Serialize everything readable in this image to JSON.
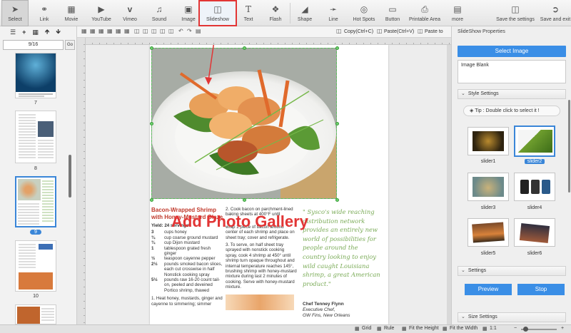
{
  "toolbar": {
    "items": [
      {
        "label": "Select",
        "icon": "arrow-icon"
      },
      {
        "label": "Link",
        "icon": "link-icon"
      },
      {
        "label": "Movie",
        "icon": "film-icon"
      },
      {
        "label": "YouTube",
        "icon": "youtube-icon"
      },
      {
        "label": "Vimeo",
        "icon": "vimeo-icon"
      },
      {
        "label": "Sound",
        "icon": "music-note-icon"
      },
      {
        "label": "Image",
        "icon": "image-icon"
      },
      {
        "label": "Slideshow",
        "icon": "slideshow-icon"
      },
      {
        "label": "Text",
        "icon": "text-icon"
      },
      {
        "label": "Flash",
        "icon": "flash-icon"
      },
      {
        "label": "Shape",
        "icon": "shape-icon"
      },
      {
        "label": "Line",
        "icon": "line-icon"
      },
      {
        "label": "Hot Spots",
        "icon": "hotspot-icon"
      },
      {
        "label": "Button",
        "icon": "button-icon"
      },
      {
        "label": "Printable Area",
        "icon": "printer-icon"
      },
      {
        "label": "more",
        "icon": "more-icon"
      },
      {
        "label": "Save the settings",
        "icon": "save-icon"
      },
      {
        "label": "Save and exit",
        "icon": "exit-icon"
      }
    ]
  },
  "left_panel": {
    "page_indicator": "9/16",
    "go_label": "Go",
    "thumbnails": [
      {
        "label": "7"
      },
      {
        "label": "8"
      },
      {
        "label": "9"
      },
      {
        "label": "10"
      }
    ]
  },
  "edit_tools": {
    "copy": "Copy(Ctrl+C)",
    "paste": "Paste(Ctrl+V)",
    "paste_to": "Paste to"
  },
  "article": {
    "title_line1": "Bacon-Wrapped Shrimp",
    "title_line2": "with Honey-Mustard Glaze",
    "yield": "Yield: 24 servings",
    "ingredients": [
      {
        "qty": "3",
        "text": "cups honey"
      },
      {
        "qty": "¾",
        "text": "cup coarse ground mustard"
      },
      {
        "qty": "¾",
        "text": "cup Dijon mustard"
      },
      {
        "qty": "1",
        "text": "tablespoon grated fresh ginger"
      },
      {
        "qty": "½",
        "text": "teaspoon cayenne pepper"
      },
      {
        "qty": "2½",
        "text": "pounds smoked bacon slices, each cut crosswise in half"
      },
      {
        "qty": "",
        "text": "Nonstick cooking spray"
      },
      {
        "qty": "5½",
        "text": "pounds raw 16-20 count tail-on, peeled and deveined Portico shrimp, thawed"
      }
    ],
    "step1": "1. Heat honey, mustards, ginger and cayenne to simmering; simmer",
    "step2": "2. Cook bacon on parchment-lined baking sheets at 400°F until",
    "step3": "wrap 1 piece of bacon around center of each shrimp and place on sheet tray; cover and refrigerate.",
    "step4": "3. To serve, on half sheet tray sprayed with nonstick cooking spray, cook 4 shrimp at 450° until shrimp turn opaque throughout and internal temperature reaches 145°, brushing shrimp with honey-mustard mixture during last 2 minutes of cooking. Serve with honey-mustard mixture.",
    "quote": "\" Sysco's wide reaching distribution network provides an entirely new world of possibilities for people around the country looking to enjoy wild caught Louisiana shrimp, a great American product.\"",
    "chef_name": "Chef Tenney Flynn",
    "chef_title": "Executive Chef,",
    "chef_place": "GW Fins, New Orleans"
  },
  "overlay_caption": "Add Photo Gallery",
  "right_panel": {
    "title": "SlideShow Properties",
    "select_image": "Select Image",
    "image_blank": "Image Blank",
    "style_settings": "Style Settings",
    "tip": "Tip : Double click to select it !",
    "sliders": [
      {
        "label": "slider1"
      },
      {
        "label": "slider2"
      },
      {
        "label": "slider3"
      },
      {
        "label": "slider4"
      },
      {
        "label": "slider5"
      },
      {
        "label": "slider6"
      }
    ],
    "settings": "Settings",
    "preview": "Preview",
    "stop": "Stop",
    "size_settings": "Size Settings"
  },
  "status_bar": {
    "grid": "Grid",
    "rule": "Rule",
    "fit_height": "Fit the Height",
    "fit_width": "Fit the Width",
    "zoom": "1:1",
    "zoom_level": 0.12
  },
  "colors": {
    "accent": "#3a8ee6",
    "highlight_red": "#e23535",
    "quote_green": "#7aab57",
    "title_red": "#c0392b"
  }
}
